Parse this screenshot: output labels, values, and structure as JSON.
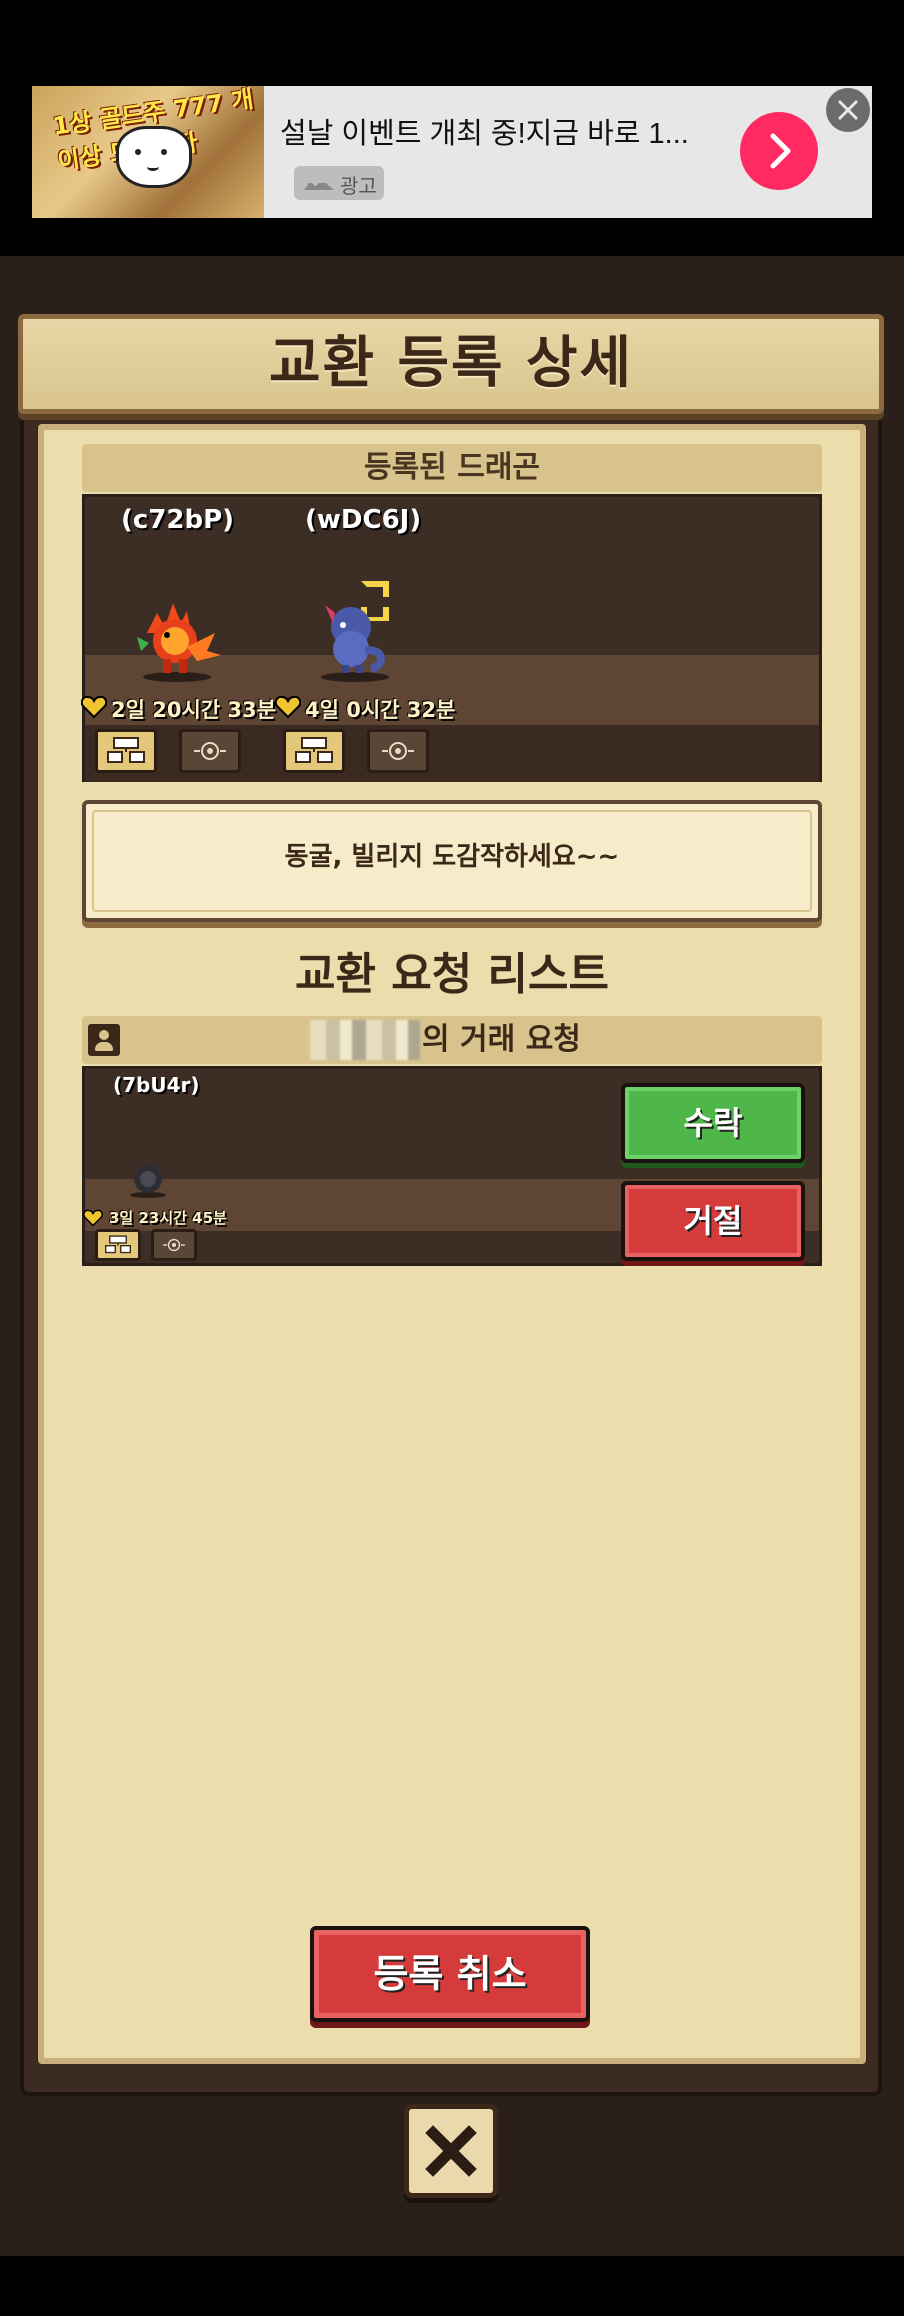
{
  "ad": {
    "image_text": "1상 골드주 777 개이상 드립니다",
    "title": "설날 이벤트 개최 중!지금 바로 1...",
    "label": "광고",
    "cta_icon": "chevron-right-icon",
    "close_icon": "close-icon"
  },
  "dialog": {
    "title": "교환 등록 상세"
  },
  "registered": {
    "header": "등록된 드래곤",
    "dragons": [
      {
        "code": "(c72bP)",
        "timer": "2일 20시간 33분",
        "sprite": "fire-dragon"
      },
      {
        "code": "(wDC6J)",
        "timer": "4일 0시간 32분",
        "sprite": "blue-dragon"
      }
    ]
  },
  "message": "동굴, 빌리지 도감작하세요~~",
  "request_list": {
    "title": "교환 요청 리스트",
    "header_suffix": "의 거래 요청",
    "request": {
      "code": "(7bU4r)",
      "timer": "3일 23시간 45분",
      "accept_label": "수락",
      "reject_label": "거절"
    }
  },
  "buttons": {
    "cancel_registration": "등록 취소",
    "close_icon": "close-x-icon"
  },
  "colors": {
    "panel_bg": "#ebdeac",
    "accept": "#4fb64a",
    "reject": "#d53b3b",
    "ad_cta": "#ff2a61"
  }
}
